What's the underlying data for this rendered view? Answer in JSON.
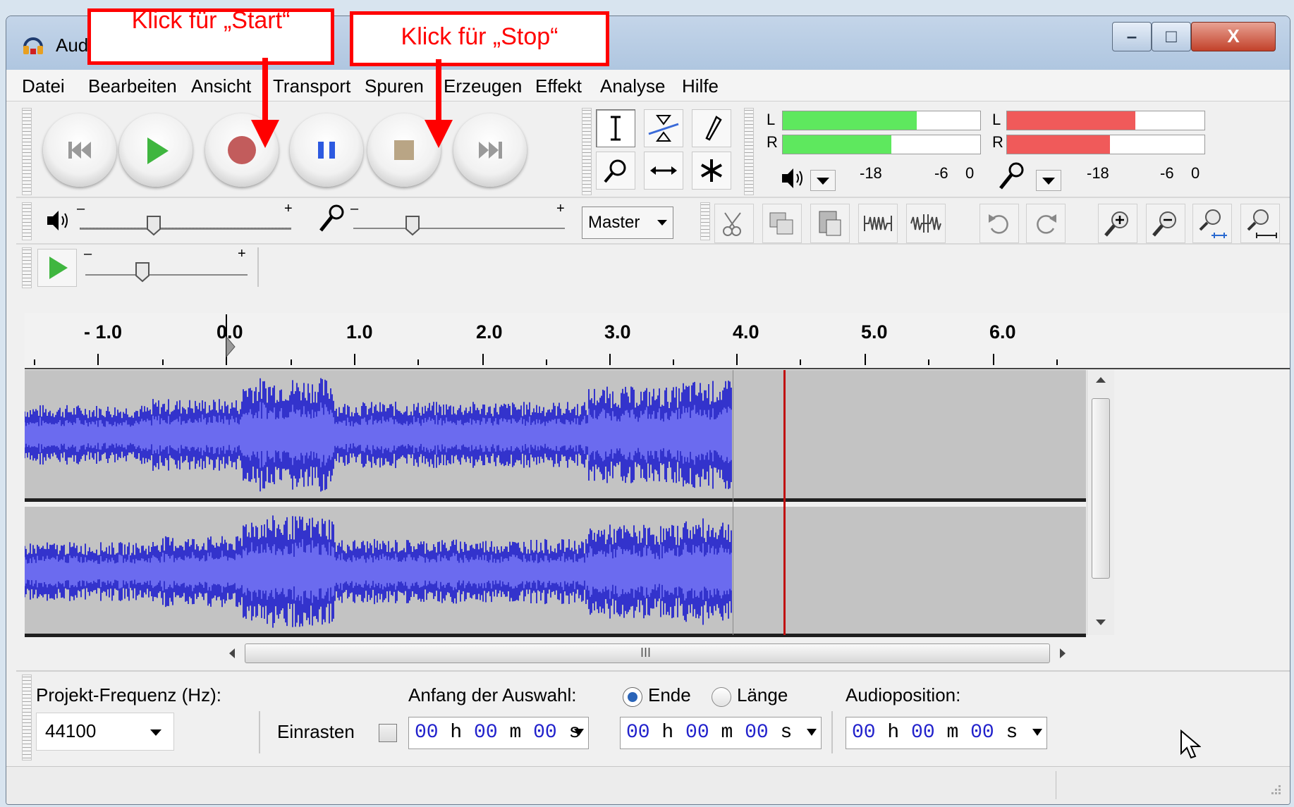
{
  "window": {
    "title": "Aud",
    "min_label": "–",
    "max_label": "□",
    "close_label": "X"
  },
  "menu": {
    "items": [
      "Datei",
      "Bearbeiten",
      "Ansicht",
      "Transport",
      "Spuren",
      "Erzeugen",
      "Effekt",
      "Analyse",
      "Hilfe"
    ]
  },
  "meters": {
    "play": {
      "left_label": "L",
      "right_label": "R",
      "scale": [
        "-18",
        "-6",
        "0"
      ],
      "left_level": 0.68,
      "right_level": 0.55,
      "color": "#5ee85e"
    },
    "record": {
      "left_label": "L",
      "right_label": "R",
      "scale": [
        "-18",
        "-6",
        "0"
      ],
      "left_level": 0.65,
      "right_level": 0.52,
      "color": "#f05a5a"
    }
  },
  "mixer": {
    "minus": "–",
    "plus": "+",
    "device": "Master",
    "playback_volume": 0.35,
    "record_volume": 0.28,
    "play_speed": 0.35
  },
  "ruler": {
    "labels": [
      "- 1.0",
      "0.0",
      "1.0",
      "2.0",
      "3.0",
      "4.0",
      "5.0",
      "6.0"
    ]
  },
  "scrollbar": {
    "grip": "III"
  },
  "selection_bar": {
    "freq_label": "Projekt-Frequenz (Hz):",
    "freq_value": "44100",
    "snap_label": "Einrasten",
    "start_label": "Anfang der Auswahl:",
    "end_option": "Ende",
    "length_option": "Länge",
    "audiopos_label": "Audioposition:",
    "time_h": "00",
    "time_m": "00",
    "time_s": "00",
    "unit_h": "h",
    "unit_m": "m",
    "unit_s": "s"
  },
  "annotations": {
    "start": "Klick für „Start“",
    "stop": "Klick für „Stop“"
  },
  "colors": {
    "waveform_outer": "#3333cc",
    "waveform_inner": "#6b6bef",
    "track_bg": "#c3c3c3",
    "cursor": "#c01010",
    "callout": "#ff0000"
  }
}
